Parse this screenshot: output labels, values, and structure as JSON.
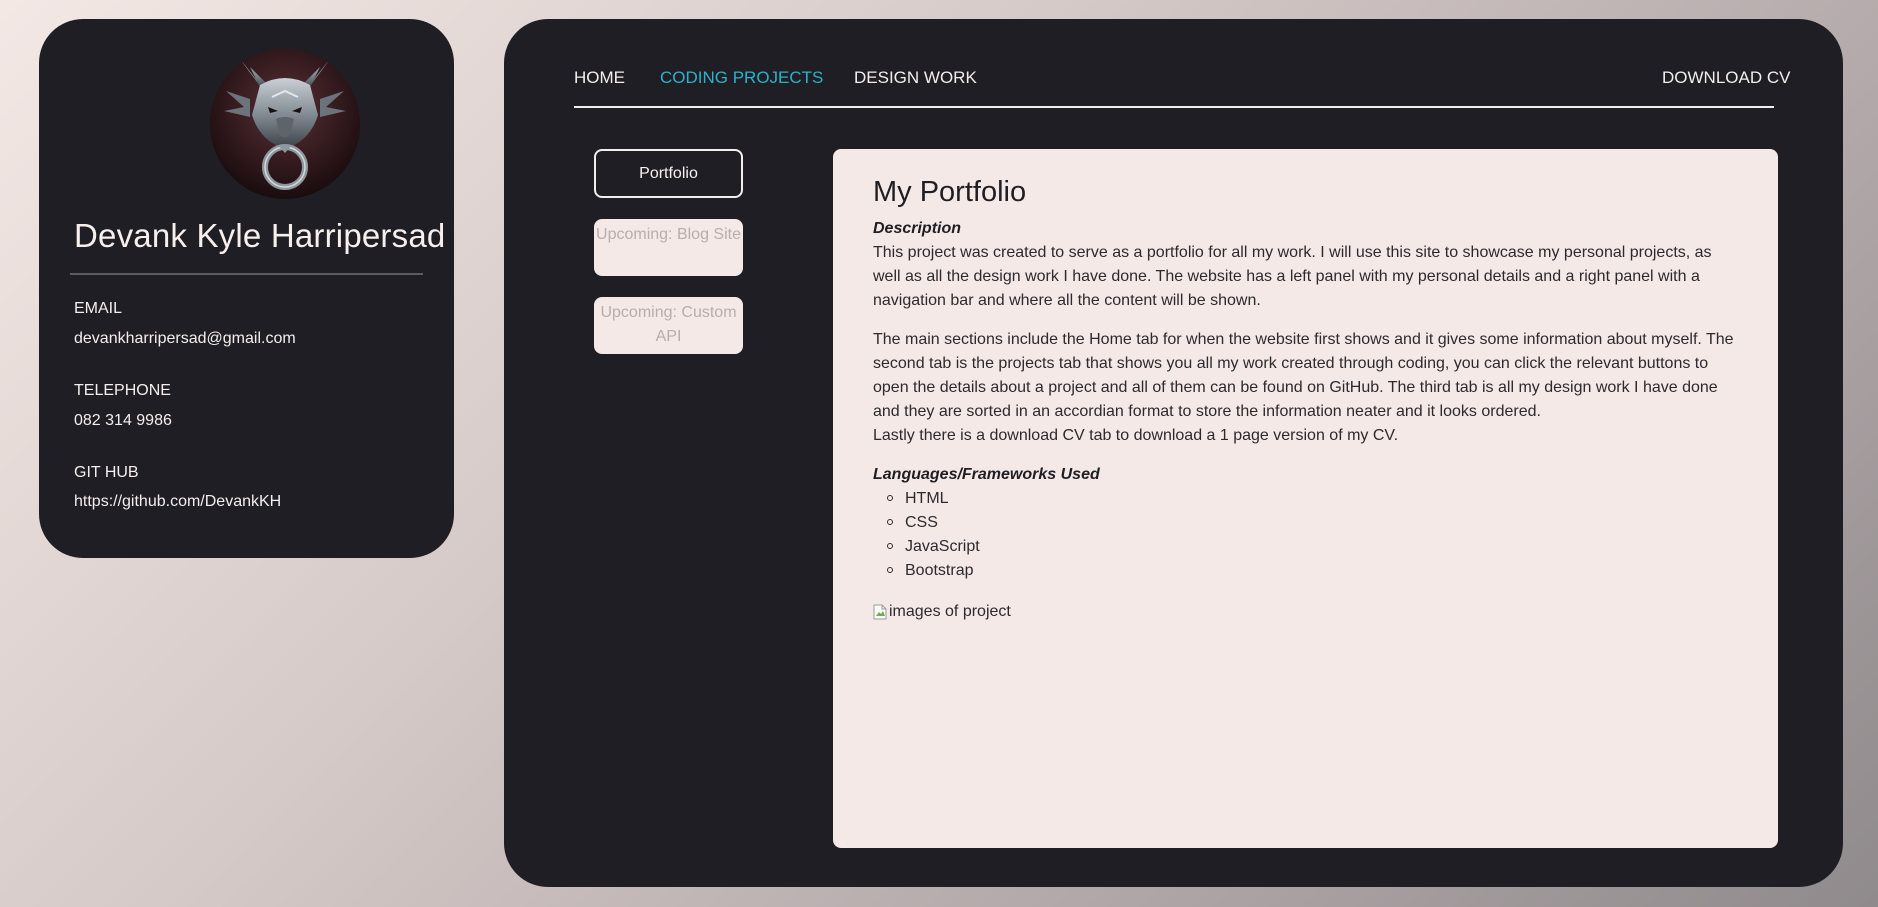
{
  "profile": {
    "name": "Devank Kyle Harripersad",
    "email_label": "EMAIL",
    "email_value": "devankharripersad@gmail.com",
    "phone_label": "TELEPHONE",
    "phone_value": "082 314 9986",
    "github_label": "GIT HUB",
    "github_value": "https://github.com/DevankKH",
    "avatar_icon": "dragon-avatar"
  },
  "nav": {
    "home": "HOME",
    "coding_projects": "CODING PROJECTS",
    "design_work": "DESIGN WORK",
    "download_cv": "DOWNLOAD CV",
    "active": "CODING PROJECTS",
    "active_color": "#2ab3cb"
  },
  "sidebar": {
    "portfolio": "Portfolio",
    "blog": "Upcoming: Blog Site",
    "api": "Upcoming: Custom API"
  },
  "content": {
    "title": "My Portfolio",
    "description_heading": "Description",
    "description_p1": "This project was created to serve as a portfolio for all my work. I will use this site to showcase my personal projects, as well as all the design work I have done. The website has a left panel with my personal details and a right panel with a navigation bar and where all the content will be shown.",
    "description_p2": "The main sections include the Home tab for when the website first shows and it gives some information about myself. The second tab is the projects tab that shows you all my work created through coding, you can click the relevant buttons to open the details about a project and all of them can be found on GitHub. The third tab is all my design work I have done and they are sorted in an accordian format to store the information neater and it looks ordered.",
    "description_p3": "Lastly there is a download CV tab to download a 1 page version of my CV.",
    "languages_heading": "Languages/Frameworks Used",
    "languages": [
      "HTML",
      "CSS",
      "JavaScript",
      "Bootstrap"
    ],
    "image_alt": "images of project"
  },
  "colors": {
    "panel_bg": "#1f1e24",
    "card_bg": "#f5e9e7",
    "accent": "#2ab3cb"
  }
}
